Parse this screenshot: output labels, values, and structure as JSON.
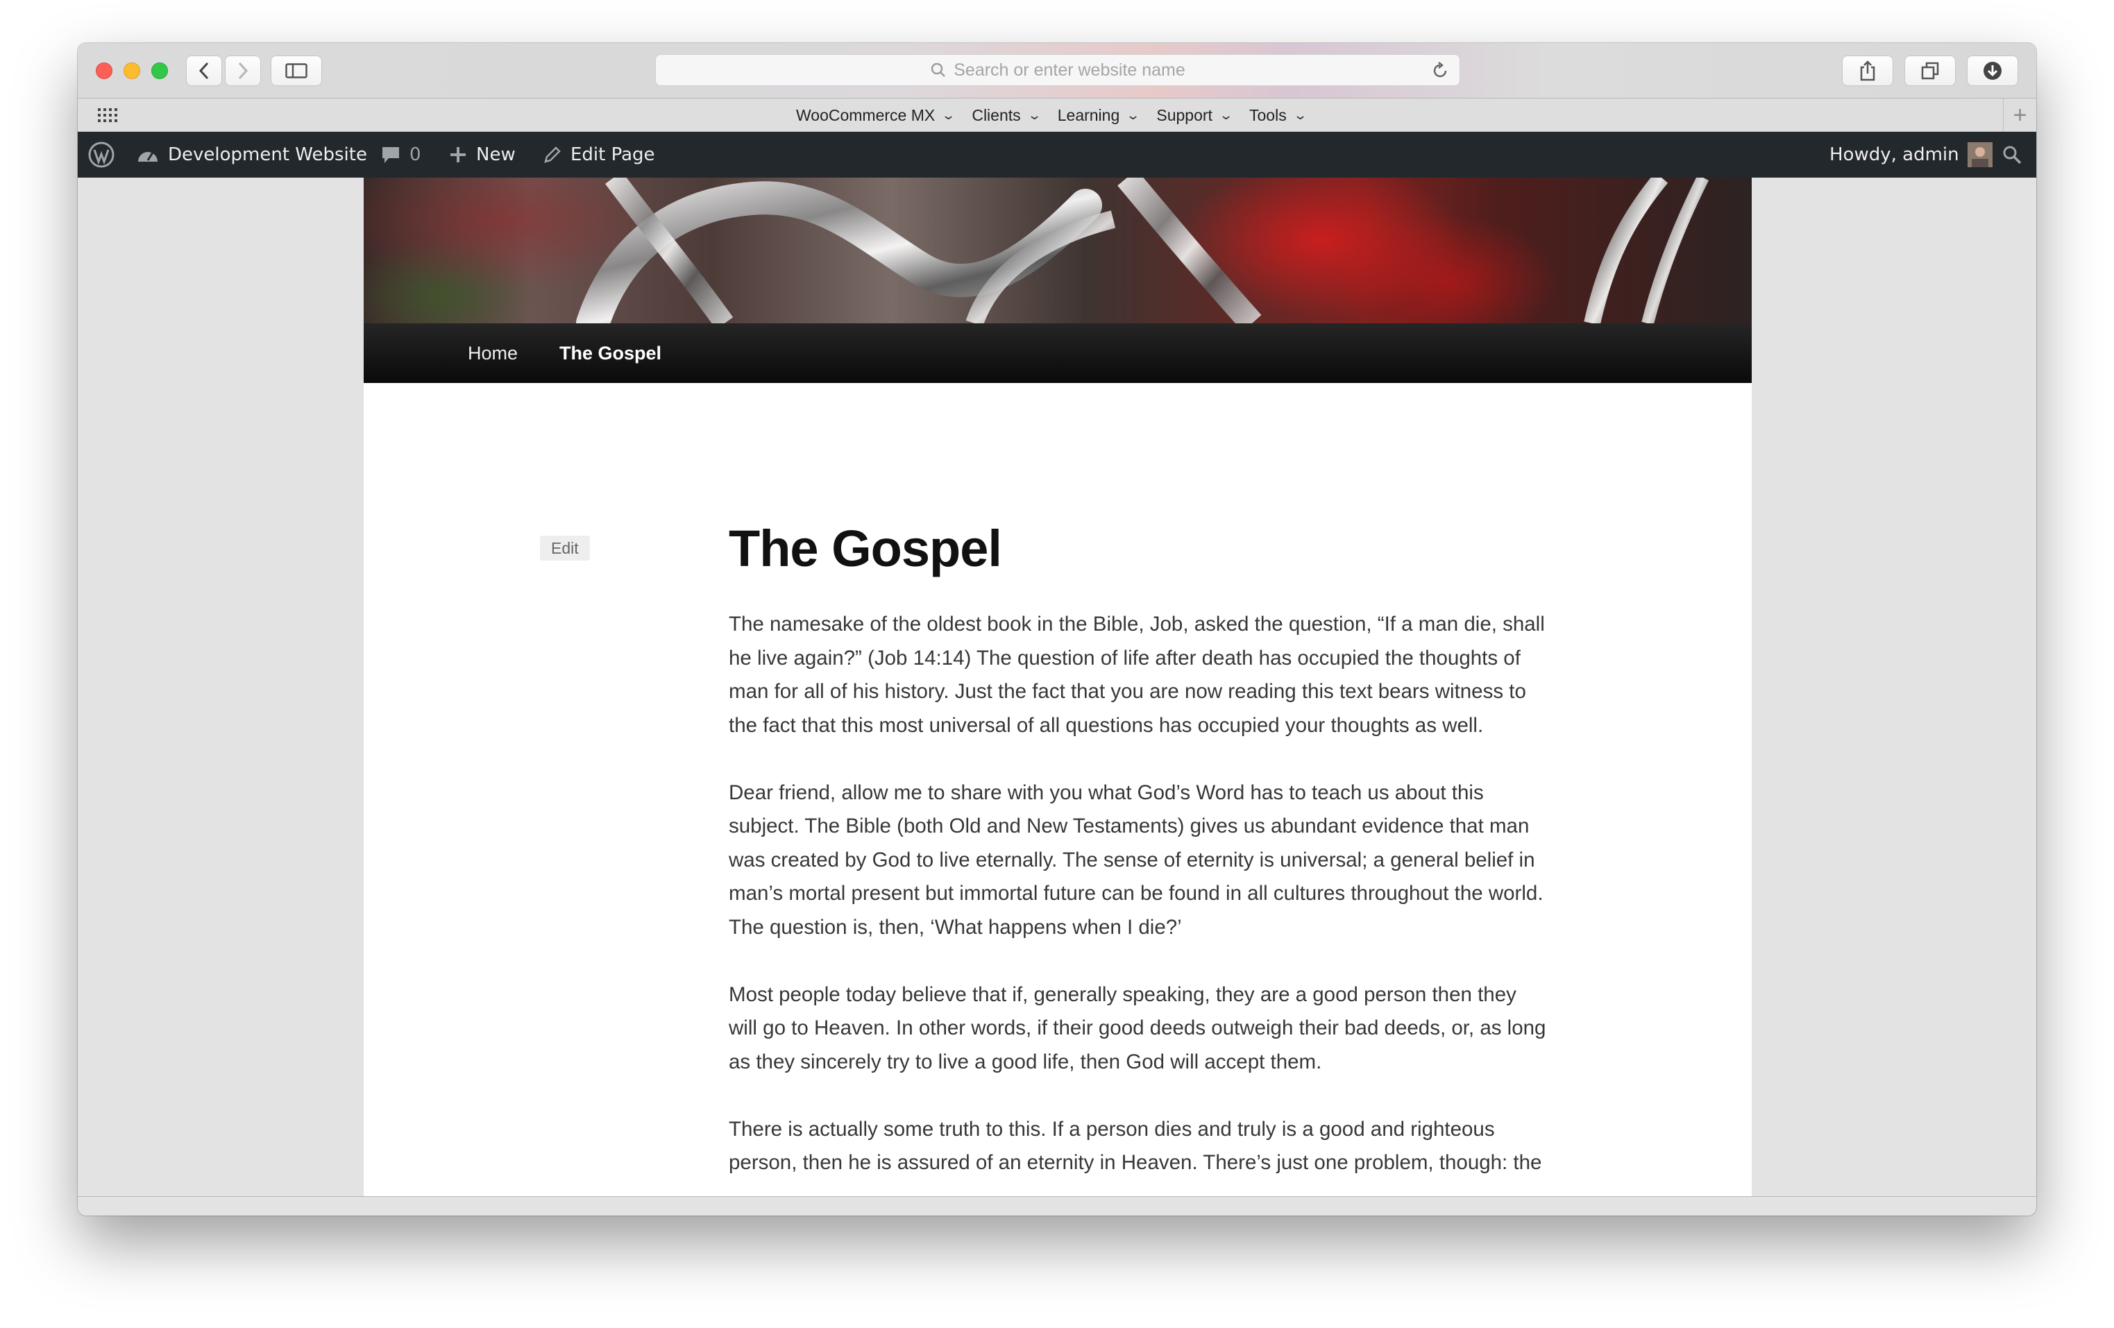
{
  "browser": {
    "address_placeholder": "Search or enter website name",
    "favorites": [
      {
        "label": "WooCommerce MX"
      },
      {
        "label": "Clients"
      },
      {
        "label": "Learning"
      },
      {
        "label": "Support"
      },
      {
        "label": "Tools"
      }
    ]
  },
  "adminbar": {
    "site_name": "Development Website",
    "comments_count": "0",
    "new_label": "New",
    "edit_page_label": "Edit Page",
    "greeting": "Howdy, admin"
  },
  "site": {
    "nav": [
      {
        "label": "Home",
        "current": false
      },
      {
        "label": "The Gospel",
        "current": true
      }
    ]
  },
  "post": {
    "edit_label": "Edit",
    "title": "The Gospel",
    "paragraphs": [
      "The namesake of the oldest book in the Bible, Job, asked the question, “If a man die, shall he live again?” (Job 14:14) The question of life after death has occupied the thoughts of man for all of his history. Just the fact that you are now reading this text bears witness to the fact that this most universal of all questions has occupied your thoughts as well.",
      "Dear friend, allow me to share with you what God’s Word has to teach us about this subject. The Bible (both Old and New Testaments) gives us abundant evidence that man was created by God to live eternally. The sense of eternity is universal; a general belief in man’s mortal present but immortal future can be found in all cultures throughout the world. The question is, then, ‘What happens when I die?’",
      "Most people today believe that if, generally speaking, they are a good person then they will go to Heaven. In other words, if their good deeds outweigh their bad deeds, or, as long as they sincerely try to live a good life, then God will accept them.",
      "There is actually some truth to this. If a person dies and truly is a good and righteous person, then he is assured of an eternity in Heaven. There’s just one problem, though: the"
    ]
  }
}
